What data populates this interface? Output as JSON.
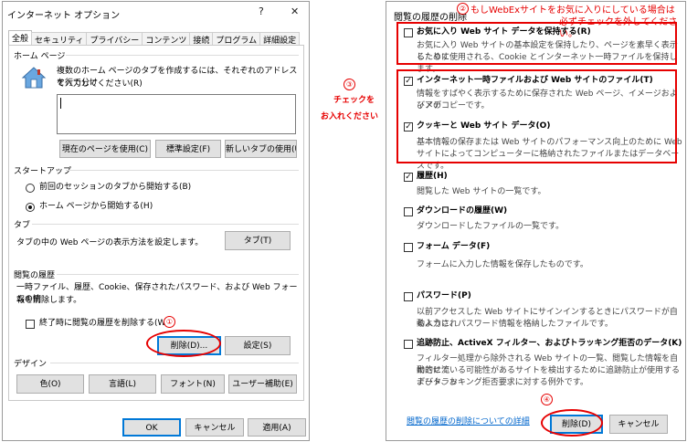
{
  "left": {
    "title": "インターネット オプション",
    "help_glyph": "?",
    "close_glyph": "✕",
    "tabs": [
      "全般",
      "セキュリティ",
      "プライバシー",
      "コンテンツ",
      "接続",
      "プログラム",
      "詳細設定"
    ],
    "homepage": {
      "heading": "ホーム ページ",
      "desc1": "複数のホーム ページのタブを作成するには、それぞれのアドレスを行で分け",
      "desc2": "て入力してください(R)",
      "buttons": [
        "現在のページを使用(C)",
        "標準設定(F)",
        "新しいタブの使用(U)"
      ]
    },
    "startup": {
      "heading": "スタートアップ",
      "option1": "前回のセッションのタブから開始する(B)",
      "option2": "ホーム ページから開始する(H)"
    },
    "tabs_section": {
      "heading": "タブ",
      "desc": "タブの中の Web ページの表示方法を設定します。",
      "button": "タブ(T)"
    },
    "history": {
      "heading": "閲覧の履歴",
      "desc1": "一時ファイル、履歴、Cookie、保存されたパスワード、および Web フォームの情",
      "desc2": "報を削除します。",
      "checkbox": "終了時に閲覧の履歴を削除する(W)",
      "delete_button": "削除(D)...",
      "settings_button": "設定(S)"
    },
    "design": {
      "heading": "デザイン",
      "buttons": [
        "色(O)",
        "言語(L)",
        "フォント(N)",
        "ユーザー補助(E)"
      ]
    },
    "footer": {
      "ok": "OK",
      "cancel": "キャンセル",
      "apply": "適用(A)"
    }
  },
  "right": {
    "title": "閲覧の履歴の削除",
    "items": [
      {
        "label": "お気に入り Web サイト データを保持する(R)",
        "checked": false,
        "desc1": "お気に入り Web サイトの基本設定を保持したり、ページを素早く表示したりす",
        "desc2": "るために使用される、Cookie とインターネット一時ファイルを保持します。"
      },
      {
        "label": "インターネット一時ファイルおよび Web サイトのファイル(T)",
        "checked": true,
        "desc1": "情報をすばやく表示するために保存された Web ページ、イメージおよびメデ",
        "desc2": "ィアのコピーです。"
      },
      {
        "label": "クッキーと Web サイト データ(O)",
        "checked": true,
        "desc1": "基本情報の保存または Web サイトのパフォーマンス向上のために Web",
        "desc2": "サイトによってコンピューターに格納されたファイルまたはデータベースです。"
      },
      {
        "label": "履歴(H)",
        "checked": true,
        "desc1": "閲覧した Web サイトの一覧です。",
        "desc2": ""
      },
      {
        "label": "ダウンロードの履歴(W)",
        "checked": false,
        "desc1": "ダウンロードしたファイルの一覧です。",
        "desc2": ""
      },
      {
        "label": "フォーム データ(F)",
        "checked": false,
        "desc1": "フォームに入力した情報を保存したものです。",
        "desc2": ""
      },
      {
        "label": "パスワード(P)",
        "checked": false,
        "desc1": "以前アクセスした Web サイトにサインインするときにパスワードが自動入力され",
        "desc2": "るように、パスワード情報を格納したファイルです。"
      },
      {
        "label": "追跡防止、ActiveX フィルター、およびトラッキング拒否のデータ(K)",
        "checked": false,
        "desc1": "フィルター処理から除外される Web サイトの一覧、閲覧した情報を自動的に流",
        "desc2": "出させている可能性があるサイトを検出するために追跡防止が使用するデータ、お",
        "desc3": "よびトラッキング拒否要求に対する例外です。"
      }
    ],
    "link": "閲覧の履歴の削除についての詳細",
    "delete_button": "削除(D)",
    "cancel_button": "キャンセル"
  },
  "annotations": {
    "n1": "①",
    "n2": "②",
    "n3": "③",
    "n4": "④",
    "note2a": "もしWebExサイトをお気に入りにしている場合は",
    "note2b": "必ずチェックを外してください。",
    "note3a": "チェックを",
    "note3b": "お入れください"
  },
  "colors": {
    "annotation": "#e60000",
    "link": "#0066cc",
    "focus": "#0078d7"
  },
  "icons": {
    "home": "house-icon"
  }
}
